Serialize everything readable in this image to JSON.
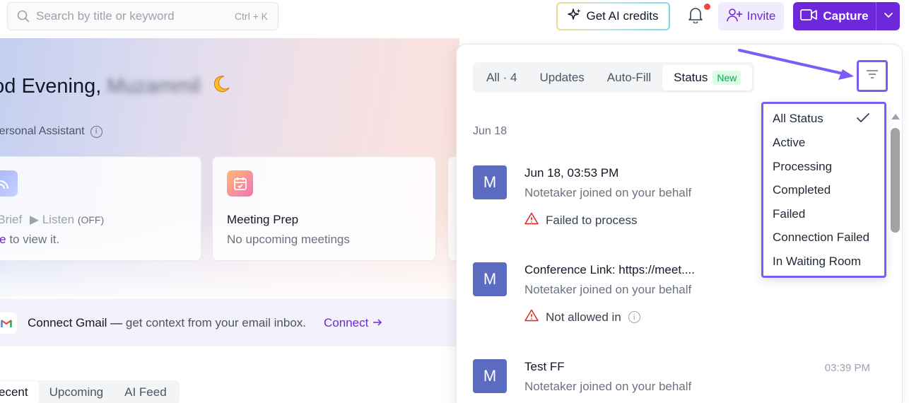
{
  "search": {
    "placeholder": "Search by title or keyword",
    "shortcut": "Ctrl + K"
  },
  "header": {
    "ai_credits_label": "Get AI credits",
    "invite_label": "Invite",
    "capture_label": "Capture"
  },
  "home": {
    "greeting": "ood Evening,",
    "user_name": "Muzammil",
    "personal_assistant_label": "Personal Assistant",
    "cards": [
      {
        "title": "aily Brief",
        "listen": "Listen",
        "listen_state": "(OFF)",
        "sub_link": "nable",
        "sub_rest": " to view it."
      },
      {
        "title": "Meeting Prep",
        "sub": "No upcoming meetings"
      }
    ],
    "gmail": {
      "bold": "Connect Gmail —",
      "text": " get context from your email inbox.",
      "connect": "Connect"
    },
    "tabs": [
      "ecent",
      "Upcoming",
      "AI Feed"
    ]
  },
  "notifications": {
    "tabs": [
      {
        "label": "All · 4"
      },
      {
        "label": "Updates"
      },
      {
        "label": "Auto-Fill"
      },
      {
        "label": "Status",
        "badge": "New"
      }
    ],
    "date_header": "Jun 18",
    "items": [
      {
        "avatar": "M",
        "title": "Jun 18, 03:53 PM",
        "sub": "Notetaker joined on your behalf",
        "status": "Failed to process",
        "time": ""
      },
      {
        "avatar": "M",
        "title": "Conference Link: https://meet....",
        "sub": "Notetaker joined on your behalf",
        "status": "Not allowed in",
        "time": ""
      },
      {
        "avatar": "M",
        "title": "Test FF",
        "sub": "Notetaker joined on your behalf",
        "status": "",
        "time": "03:39 PM"
      }
    ]
  },
  "status_filter": {
    "options": [
      "All Status",
      "Active",
      "Processing",
      "Completed",
      "Failed",
      "Connection Failed",
      "In Waiting Room"
    ],
    "selected": "All Status"
  },
  "colors": {
    "accent": "#6d28d9",
    "annotation": "#7c5cf5",
    "avatar": "#5b6bc0",
    "warning": "#dc2626"
  }
}
